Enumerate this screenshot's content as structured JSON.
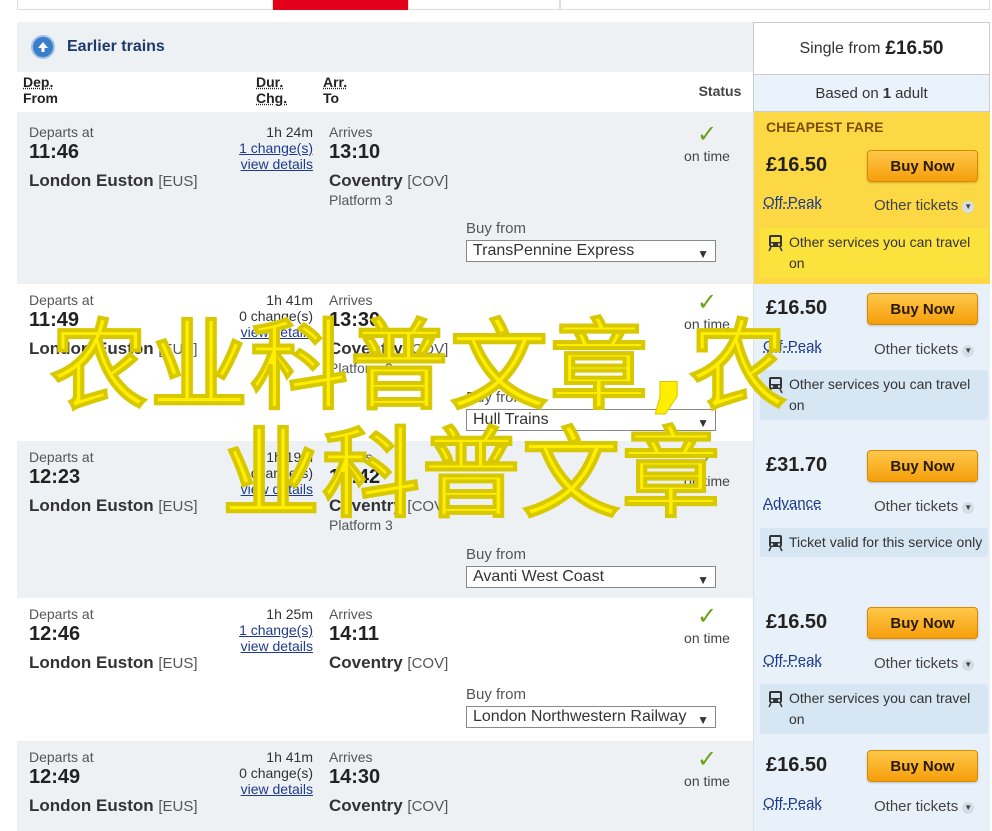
{
  "earlier": {
    "label": "Earlier trains"
  },
  "fare_header": {
    "prefix": "Single from",
    "price": "£16.50",
    "based_pre": "Based on",
    "based_count": "1",
    "based_post": "adult"
  },
  "columns": {
    "dep_line1": "Dep.",
    "dep_line2": "From",
    "dur_line1": "Dur.",
    "dur_line2": "Chg.",
    "arr_line1": "Arr.",
    "arr_line2": "To",
    "status": "Status"
  },
  "labels": {
    "departs_at": "Departs at",
    "arrives": "Arrives",
    "buy_from": "Buy from",
    "buy_now": "Buy Now",
    "other_tickets": "Other tickets",
    "cheapest_fare": "CHEAPEST FARE"
  },
  "journeys": [
    {
      "dep_time": "11:46",
      "dep_station": "London Euston",
      "dep_code": "[EUS]",
      "duration": "1h 24m",
      "changes": "1 change(s)",
      "details": "view details",
      "arr_time": "13:10",
      "arr_station": "Coventry",
      "arr_code": "[COV]",
      "platform": "Platform 3",
      "status": "on time",
      "operator": "TransPennine Express",
      "price": "£16.50",
      "ticket_type": "Off-Peak",
      "notice": "Other services you can travel on"
    },
    {
      "dep_time": "11:49",
      "dep_station": "London Euston",
      "dep_code": "[EUS]",
      "duration": "1h 41m",
      "changes": "0 change(s)",
      "details": "view details",
      "arr_time": "13:30",
      "arr_station": "Coventry",
      "arr_code": "[COV]",
      "platform": "Platform 3",
      "status": "on time",
      "operator": "Hull Trains",
      "price": "£16.50",
      "ticket_type": "Off-Peak",
      "notice": "Other services you can travel on"
    },
    {
      "dep_time": "12:23",
      "dep_station": "London Euston",
      "dep_code": "[EUS]",
      "duration": "1h 19m",
      "changes": "0 change(s)",
      "details": "view details",
      "arr_time": "13:42",
      "arr_station": "Coventry",
      "arr_code": "[COV]",
      "platform": "Platform 3",
      "status": "on time",
      "operator": "Avanti West Coast",
      "price": "£31.70",
      "ticket_type": "Advance",
      "notice": "Ticket valid for this service only"
    },
    {
      "dep_time": "12:46",
      "dep_station": "London Euston",
      "dep_code": "[EUS]",
      "duration": "1h 25m",
      "changes": "1 change(s)",
      "details": "view details",
      "arr_time": "14:11",
      "arr_station": "Coventry",
      "arr_code": "[COV]",
      "platform": "",
      "status": "on time",
      "operator": "London Northwestern Railway",
      "price": "£16.50",
      "ticket_type": "Off-Peak",
      "notice": "Other services you can travel on"
    },
    {
      "dep_time": "12:49",
      "dep_station": "London Euston",
      "dep_code": "[EUS]",
      "duration": "1h 41m",
      "changes": "0 change(s)",
      "details": "view details",
      "arr_time": "14:30",
      "arr_station": "Coventry",
      "arr_code": "[COV]",
      "platform": "",
      "status": "on time",
      "operator": "",
      "price": "£16.50",
      "ticket_type": "Off-Peak",
      "notice": ""
    }
  ],
  "watermark": {
    "line1": "农业科普文章,农",
    "line2": "业科普文章"
  }
}
